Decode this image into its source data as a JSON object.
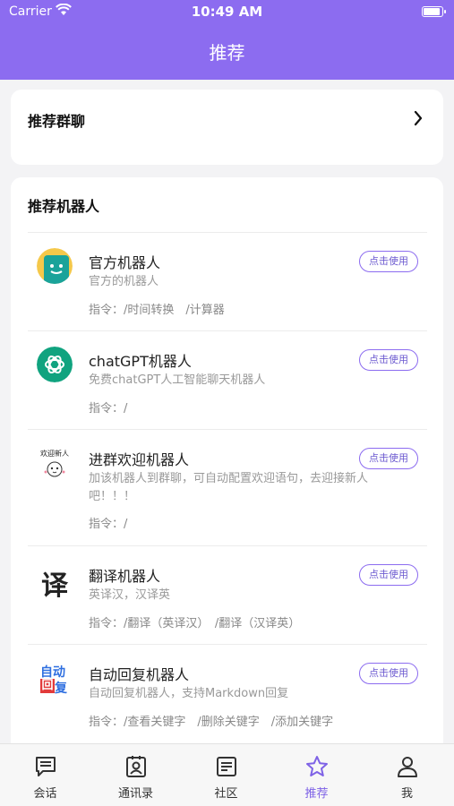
{
  "status": {
    "carrier": "Carrier",
    "time": "10:49 AM"
  },
  "header": {
    "title": "推荐"
  },
  "groups": {
    "label": "推荐群聊"
  },
  "robots": {
    "section_title": "推荐机器人",
    "use_label": "点击使用",
    "items": [
      {
        "name": "官方机器人",
        "desc": "官方的机器人",
        "cmd": "指令：/时间转换　/计算器",
        "avatar_icon": "official-bot-icon"
      },
      {
        "name": "chatGPT机器人",
        "desc": "免费chatGPT人工智能聊天机器人",
        "cmd": "指令：/",
        "avatar_icon": "chatgpt-logo-icon"
      },
      {
        "name": "进群欢迎机器人",
        "desc": "加该机器人到群聊，可自动配置欢迎语句，去迎接新人吧！！！",
        "cmd": "指令：/",
        "avatar_icon": "welcome-new-member-icon",
        "avatar_text": "欢迎新人"
      },
      {
        "name": "翻译机器人",
        "desc": "英译汉，汉译英",
        "cmd": "指令：/翻译（英译汉）　/翻译（汉译英）",
        "avatar_icon": "translate-icon",
        "avatar_text": "译"
      },
      {
        "name": "自动回复机器人",
        "desc": "自动回复机器人，支持Markdown回复",
        "cmd": "指令：/查看关键字　/删除关键字　/添加关键字",
        "avatar_icon": "auto-reply-icon",
        "avatar_text_top": "自动",
        "avatar_text_bottom1": "回",
        "avatar_text_bottom2": "复"
      }
    ]
  },
  "tabs": [
    {
      "label": "会话",
      "icon": "chat-icon"
    },
    {
      "label": "通讯录",
      "icon": "contacts-icon"
    },
    {
      "label": "社区",
      "icon": "community-icon"
    },
    {
      "label": "推荐",
      "icon": "star-icon",
      "active": true
    },
    {
      "label": "我",
      "icon": "profile-icon"
    }
  ],
  "colors": {
    "accent": "#8c6cf0",
    "background": "#f3f3f5"
  }
}
